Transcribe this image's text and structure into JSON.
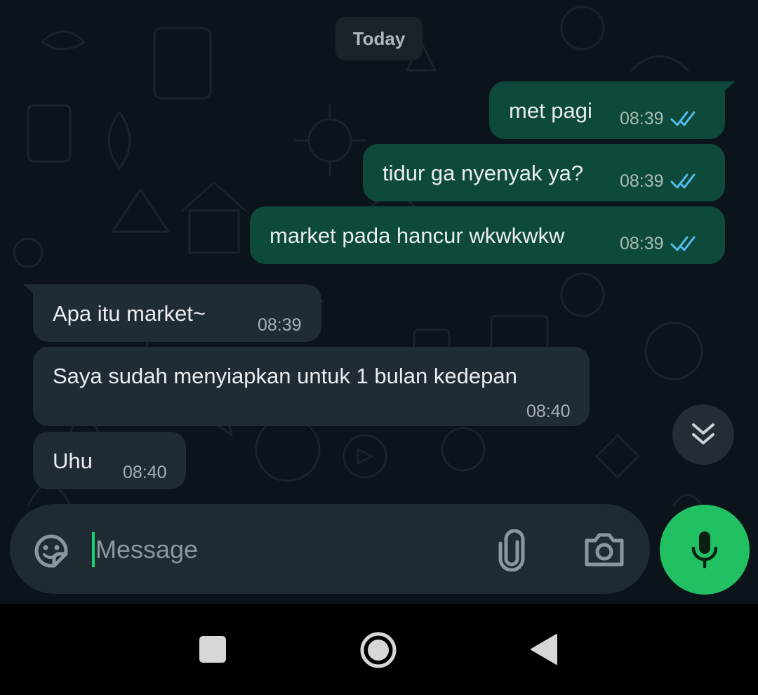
{
  "chat": {
    "date_label": "Today",
    "messages": [
      {
        "direction": "outgoing",
        "text": "met pagi",
        "time": "08:39",
        "status": "read"
      },
      {
        "direction": "outgoing",
        "text": "tidur ga nyenyak ya?",
        "time": "08:39",
        "status": "read"
      },
      {
        "direction": "outgoing",
        "text": "market pada hancur wkwkwkw",
        "time": "08:39",
        "status": "read"
      },
      {
        "direction": "incoming",
        "text": "Apa itu market~",
        "time": "08:39"
      },
      {
        "direction": "incoming",
        "text": "Saya sudah menyiapkan untuk 1 bulan kedepan",
        "time": "08:40"
      },
      {
        "direction": "incoming",
        "text": "Uhu",
        "time": "08:40"
      }
    ]
  },
  "composer": {
    "placeholder": "Message",
    "icons": {
      "emoji": "sticker-emoji-icon",
      "attach": "paperclip-icon",
      "camera": "camera-icon",
      "mic": "microphone-icon"
    }
  },
  "scroll_button": {
    "icon": "double-chevron-down-icon"
  },
  "navbar": {
    "icons": [
      "recent-apps-icon",
      "home-icon",
      "back-icon"
    ]
  },
  "colors": {
    "background": "#0b141a",
    "outgoing_bubble": "#0e4a3b",
    "incoming_bubble": "#202c33",
    "read_tick": "#53bdeb",
    "accent_green": "#21c063"
  }
}
